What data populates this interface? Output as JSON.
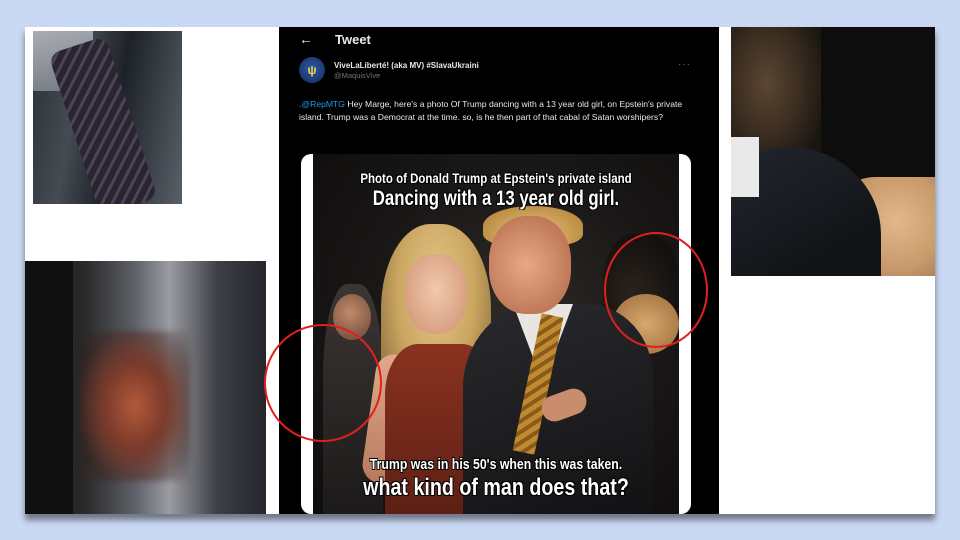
{
  "tweet": {
    "header_title": "Tweet",
    "back_glyph": "←",
    "author": {
      "display_name": "ViveLaLiberté! (aka MV) #SlavaUkraini",
      "handle": "@MaquisVive",
      "avatar_icon": "trident-avatar-icon"
    },
    "more_glyph": "···",
    "text": {
      "mention": ".@RepMTG",
      "body": " Hey Marge, here's a photo Of Trump dancing with a 13 year old girl, on Epstein's private island. Trump was a Democrat at the time. so, is he then part of that cabal of Satan worshipers?"
    },
    "media": {
      "caption_top_line1": "Photo of Donald Trump at Epstein's private island",
      "caption_top_line2": "Dancing with a 13 year old girl.",
      "caption_bottom_line1": "Trump was in his 50's when this was taken.",
      "caption_bottom_line2": "what kind of man does that?"
    }
  },
  "colors": {
    "page_background": "#c9d8f3",
    "tweet_background": "#000000",
    "mention": "#1d9bf0",
    "highlight_circle": "#e0201e"
  }
}
